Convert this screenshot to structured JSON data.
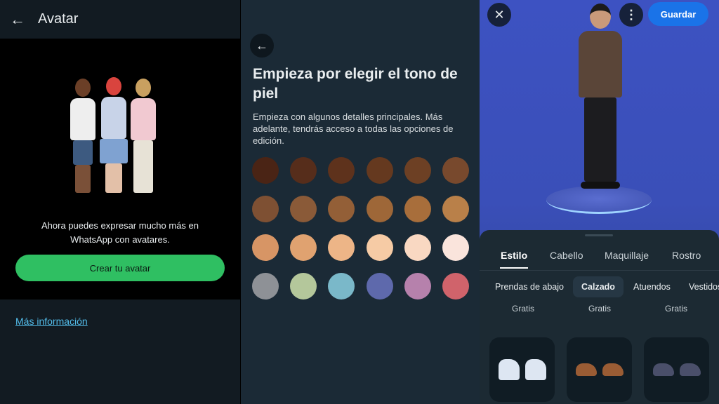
{
  "left": {
    "title": "Avatar",
    "back_icon": "arrow-left-icon",
    "message": "Ahora puedes expresar mucho más en WhatsApp con avatares.",
    "create_button": "Crear tu avatar",
    "more_info_link": "Más información"
  },
  "middle": {
    "back_icon": "arrow-left-icon",
    "title": "Empieza por elegir el tono de piel",
    "subtitle": "Empieza con algunos detalles principales. Más adelante, tendrás acceso a todas las opciones de edición.",
    "swatches": [
      "#4a2415",
      "#562d1b",
      "#5e321c",
      "#65391f",
      "#6d4024",
      "#78492d",
      "#7e5033",
      "#8a5a38",
      "#935f37",
      "#9e6738",
      "#a86e3b",
      "#b98049",
      "#d79565",
      "#e0a270",
      "#edb587",
      "#f6cba5",
      "#f9d8c2",
      "#fae4dc",
      "#8e9196",
      "#b4c79b",
      "#7ab8c9",
      "#5e69ac",
      "#b681ac",
      "#d0636b"
    ]
  },
  "right": {
    "close_icon": "close-icon",
    "more_icon": "more-vertical-icon",
    "save_button": "Guardar",
    "tabs": [
      "Estilo",
      "Cabello",
      "Maquillaje",
      "Rostro"
    ],
    "active_tab": "Estilo",
    "categories": [
      "Prendas de abajo",
      "Calzado",
      "Atuendos",
      "Vestidos"
    ],
    "active_category": "Calzado",
    "prices": [
      "Gratis",
      "Gratis",
      "Gratis"
    ],
    "items": [
      {
        "icon": "socks-sandals-icon",
        "color": "#dde6f2"
      },
      {
        "icon": "brown-shoes-icon",
        "color": "#9a5c34"
      },
      {
        "icon": "sneakers-icon",
        "color": "#4a4f6a"
      }
    ]
  }
}
